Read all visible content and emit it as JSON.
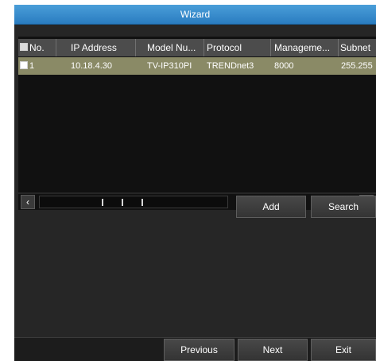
{
  "window": {
    "title": "Wizard"
  },
  "table": {
    "columns": [
      "No.",
      "IP Address",
      "Model Nu...",
      "Protocol",
      "Manageme...",
      "Subnet"
    ],
    "rows": [
      {
        "no": "1",
        "ip": "10.18.4.30",
        "model": "TV-IP310PI",
        "protocol": "TRENDnet3",
        "port": "8000",
        "subnet": "255.255"
      }
    ]
  },
  "scrollbar": {
    "left_arrow": "‹",
    "right_arrow": "›"
  },
  "actions": {
    "add_label": "Add",
    "search_label": "Search"
  },
  "footer": {
    "previous_label": "Previous",
    "next_label": "Next",
    "exit_label": "Exit"
  },
  "colors": {
    "title_bar": "#2a7cc0",
    "selected_row": "#8a8a66",
    "background": "#262626"
  }
}
